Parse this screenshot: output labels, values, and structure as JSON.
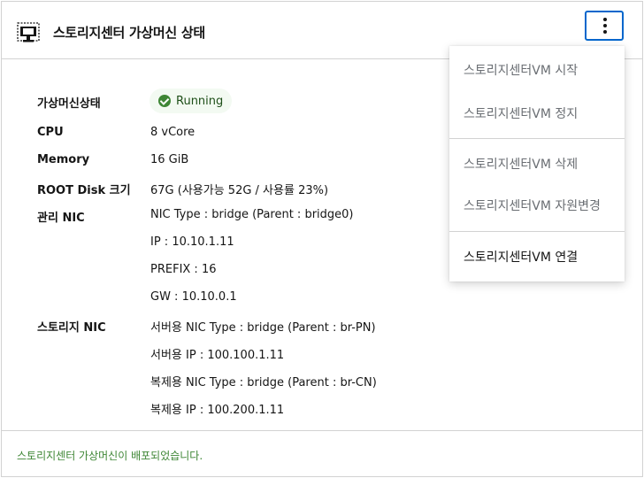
{
  "card": {
    "title": "스토리지센터 가상머신 상태",
    "status": {
      "label": "가상머신상태",
      "value": "Running"
    },
    "rows": [
      {
        "label": "CPU",
        "value": "8 vCore"
      },
      {
        "label": "Memory",
        "value": "16 GiB"
      },
      {
        "label": "ROOT Disk 크기",
        "value": "67G (사용가능 52G / 사용률 23%)"
      }
    ],
    "mgmt_nic": {
      "label": "관리 NIC",
      "lines": [
        "NIC Type : bridge (Parent : bridge0)",
        "IP : 10.10.1.11",
        "PREFIX : 16",
        "GW : 10.10.0.1"
      ]
    },
    "storage_nic": {
      "label": "스토리지 NIC",
      "lines": [
        "서버용 NIC Type : bridge (Parent : br-PN)",
        "서버용 IP : 100.100.1.11",
        "복제용 NIC Type : bridge (Parent : br-CN)",
        "복제용 IP : 100.200.1.11"
      ]
    },
    "footer_message": "스토리지센터 가상머신이 배포되었습니다."
  },
  "menu": {
    "items": [
      "스토리지센터VM 시작",
      "스토리지센터VM 정지",
      "스토리지센터VM 삭제",
      "스토리지센터VM 자원변경",
      "스토리지센터VM 연결"
    ]
  },
  "icons": {
    "vm": "monitor-icon",
    "kebab": "kebab-icon",
    "status": "check-circle-icon"
  },
  "colors": {
    "accent": "#0066cc",
    "success": "#3e8635",
    "border": "#d2d2d2"
  }
}
